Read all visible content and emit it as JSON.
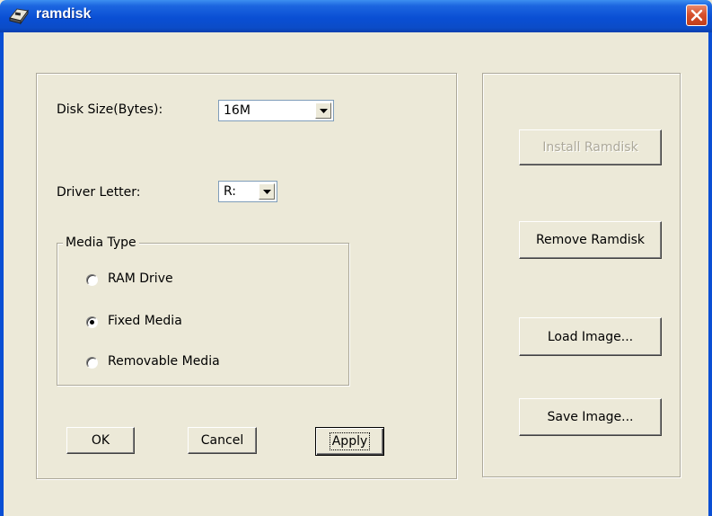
{
  "window": {
    "title": "ramdisk",
    "icon": "ramdisk-app-icon"
  },
  "disk_size": {
    "label": "Disk Size(Bytes):",
    "value": "16M"
  },
  "drive_letter": {
    "label": "Driver Letter:",
    "value": "R:"
  },
  "media_type": {
    "legend": "Media Type",
    "options": [
      {
        "label": "RAM Drive",
        "selected": false
      },
      {
        "label": "Fixed Media",
        "selected": true
      },
      {
        "label": "Removable Media",
        "selected": false
      }
    ]
  },
  "dialog_buttons": {
    "ok": "OK",
    "cancel": "Cancel",
    "apply": "Apply"
  },
  "side_buttons": {
    "install": {
      "label": "Install Ramdisk",
      "enabled": false
    },
    "remove": "Remove Ramdisk",
    "load": "Load Image...",
    "save": "Save Image..."
  },
  "colors": {
    "titlebar": "#0a4fd4",
    "face": "#ece9d8",
    "close": "#d7502c"
  }
}
